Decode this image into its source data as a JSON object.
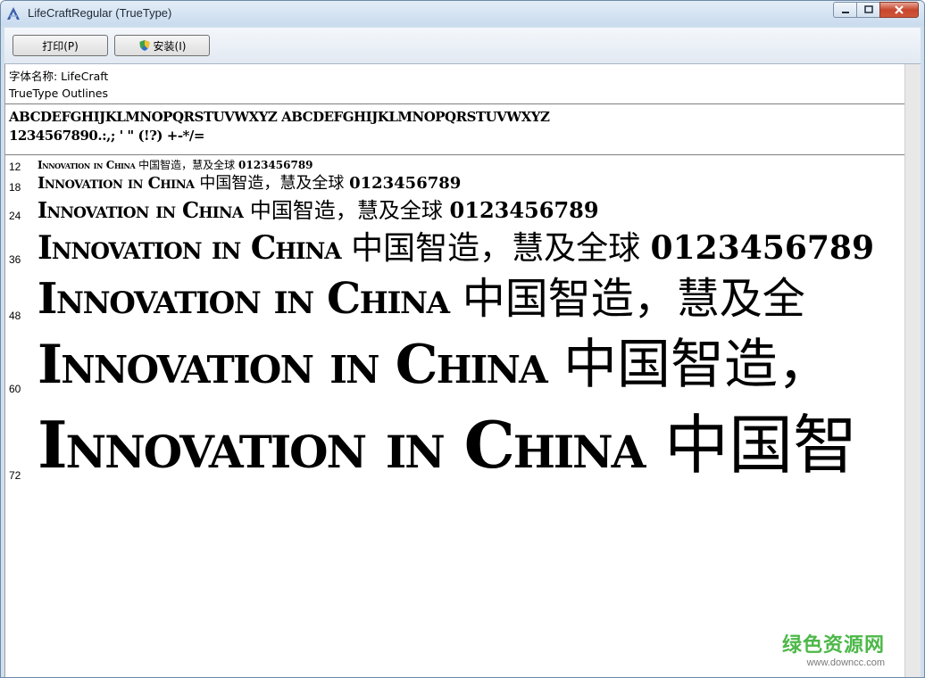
{
  "window": {
    "title": "LifeCraftRegular (TrueType)"
  },
  "toolbar": {
    "print_label": "打印(P)",
    "install_label": "安装(I)"
  },
  "font_info": {
    "name_line": "字体名称: LifeCraft",
    "type_line": "TrueType Outlines"
  },
  "charset": {
    "letters": "ABCDEFGHIJKLMNOPQRSTUVWXYZ ABCDEFGHIJKLMNOPQRSTUVWXYZ",
    "symbols": "1234567890.:,; ' \" (!?) +-*/="
  },
  "samples": [
    {
      "size": "12",
      "latin": "Innovation in China",
      "cjk": "中国智造，慧及全球",
      "digits": "0123456789"
    },
    {
      "size": "18",
      "latin": "Innovation in China",
      "cjk": "中国智造，慧及全球",
      "digits": "0123456789"
    },
    {
      "size": "24",
      "latin": "Innovation in China",
      "cjk": "中国智造，慧及全球",
      "digits": "0123456789"
    },
    {
      "size": "36",
      "latin": "Innovation in China",
      "cjk": "中国智造，慧及全球",
      "digits": "0123456789"
    },
    {
      "size": "48",
      "latin": "Innovation in China",
      "cjk": "中国智造，慧及全",
      "digits": ""
    },
    {
      "size": "60",
      "latin": "Innovation in China",
      "cjk": "中国智造，",
      "digits": ""
    },
    {
      "size": "72",
      "latin": "Innovation in China",
      "cjk": "中国智",
      "digits": ""
    }
  ],
  "watermark": {
    "main": "绿色资源网",
    "url": "www.downcc.com"
  }
}
